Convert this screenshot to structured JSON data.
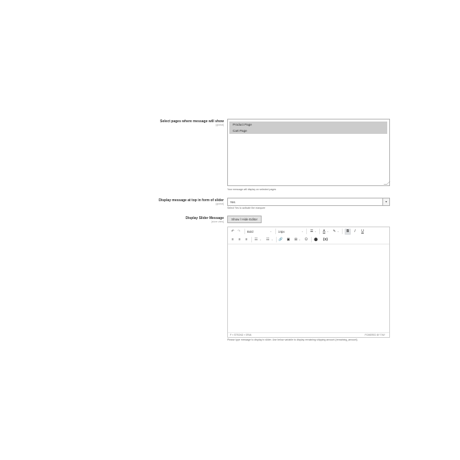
{
  "pages_field": {
    "label": "Select pages where message will show",
    "scope": "[global]",
    "options": [
      "Product Page",
      "Cart Page"
    ],
    "note": "Your message will display on selected pages"
  },
  "slider_field": {
    "label": "Display message at top in form of slider",
    "scope": "[global]",
    "value": "Yes",
    "note": "Select Yes to activate the marquee"
  },
  "message_field": {
    "label": "Display Slider Message",
    "scope": "[store view]",
    "editor_toggle": "Show / Hide Editor",
    "toolbar": {
      "format": "Bold",
      "font_size": "14px",
      "special_char": "Ω",
      "variable": "{x}"
    },
    "status_path": "P » STRONG » SPAN",
    "powered": "POWERED BY TINY",
    "note": "Please type message to display in slider. Use below variable to display remaining shipping amount {remaining_amount}"
  }
}
